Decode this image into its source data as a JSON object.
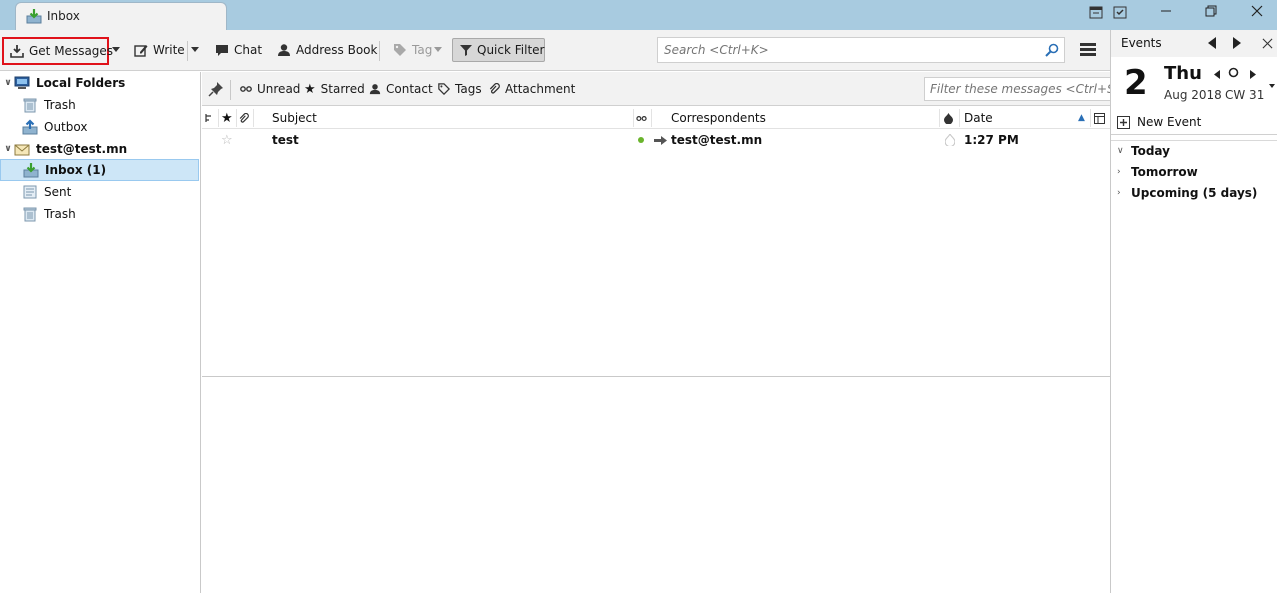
{
  "window": {
    "tab_title": "Inbox",
    "controls": [
      "calendar-icon",
      "tasks-icon",
      "minimize-icon",
      "restore-icon",
      "close-icon"
    ]
  },
  "toolbar": {
    "get_messages": "Get Messages",
    "write": "Write",
    "chat": "Chat",
    "address_book": "Address Book",
    "tag": "Tag",
    "quick_filter": "Quick Filter",
    "search_placeholder": "Search <Ctrl+K>"
  },
  "folders": [
    {
      "label": "Local Folders",
      "icon": "computer-icon",
      "level": 0,
      "bold": true,
      "expanded": true
    },
    {
      "label": "Trash",
      "icon": "trash-icon",
      "level": 1
    },
    {
      "label": "Outbox",
      "icon": "outbox-icon",
      "level": 1
    },
    {
      "label": "test@test.mn",
      "icon": "account-icon",
      "level": 0,
      "bold": true,
      "expanded": true
    },
    {
      "label": "Inbox (1)",
      "icon": "inbox-icon",
      "level": 1,
      "bold": true,
      "selected": true
    },
    {
      "label": "Sent",
      "icon": "sent-icon",
      "level": 1
    },
    {
      "label": "Trash",
      "icon": "trash-icon",
      "level": 1
    }
  ],
  "quick_filter_bar": {
    "unread": "Unread",
    "starred": "Starred",
    "contact": "Contact",
    "tags": "Tags",
    "attachment": "Attachment",
    "filter_placeholder": "Filter these messages <Ctrl+Shift+K>"
  },
  "thread_columns": {
    "subject": "Subject",
    "correspondents": "Correspondents",
    "date": "Date"
  },
  "messages": [
    {
      "subject": "test",
      "correspondent": "test@test.mn",
      "date": "1:27 PM",
      "unread": true,
      "starred": false
    }
  ],
  "today_pane": {
    "title": "Events",
    "day_number": "2",
    "day_name": "Thu",
    "month_year": "Aug 2018",
    "calendar_week": "CW 31",
    "new_event": "New Event",
    "agenda": [
      {
        "label": "Today",
        "expanded": true
      },
      {
        "label": "Tomorrow",
        "expanded": false
      },
      {
        "label": "Upcoming (5 days)",
        "expanded": false
      }
    ]
  },
  "colors": {
    "titlebar": "#a8cbe0",
    "toolbar": "#f2f2f2",
    "selection": "#cde6f7",
    "highlight_box": "#e0121a",
    "unread_dot": "#6ab42c"
  }
}
